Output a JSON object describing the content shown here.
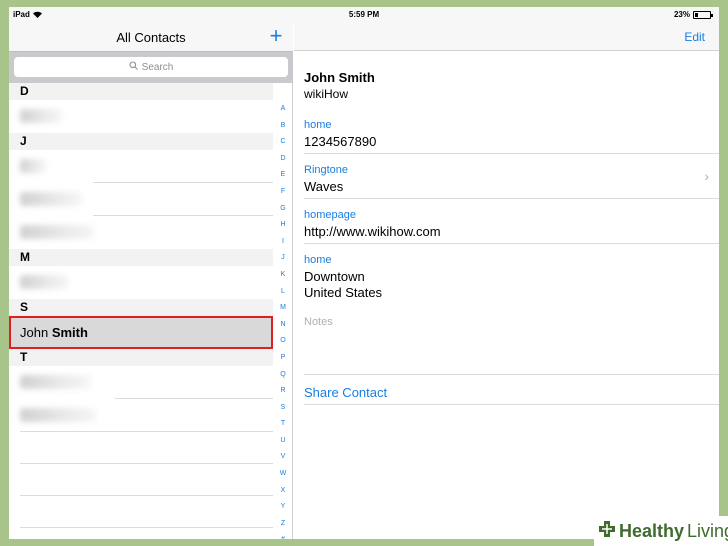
{
  "status_bar": {
    "device": "iPad",
    "time": "5:59 PM",
    "battery": "23%",
    "battery_level": 0.23
  },
  "left_pane": {
    "title": "All Contacts",
    "add_label": "+",
    "search_placeholder": "Search",
    "sections": [
      "D",
      "J",
      "M",
      "S",
      "T"
    ],
    "selected_contact": {
      "first": "John",
      "last": "Smith"
    },
    "index_letters": [
      "A",
      "B",
      "C",
      "D",
      "E",
      "F",
      "G",
      "H",
      "I",
      "J",
      "K",
      "L",
      "M",
      "N",
      "O",
      "P",
      "Q",
      "R",
      "S",
      "T",
      "U",
      "V",
      "W",
      "X",
      "Y",
      "Z",
      "#"
    ]
  },
  "detail": {
    "edit_label": "Edit",
    "name": "John Smith",
    "company": "wikiHow",
    "fields": [
      {
        "label": "home",
        "value": "1234567890"
      },
      {
        "label": "Ringtone",
        "value": "Waves"
      },
      {
        "label": "homepage",
        "value": "http://www.wikihow.com"
      },
      {
        "label": "home",
        "value_line1": "Downtown",
        "value_line2": "United States"
      }
    ],
    "notes_placeholder": "Notes",
    "share_label": "Share Contact"
  },
  "watermark": {
    "part1": "Healthy",
    "part2": "Living"
  },
  "colors": {
    "accent": "#1a7ee0",
    "selection_border": "#e02020",
    "watermark_green": "#3f6b2d"
  }
}
